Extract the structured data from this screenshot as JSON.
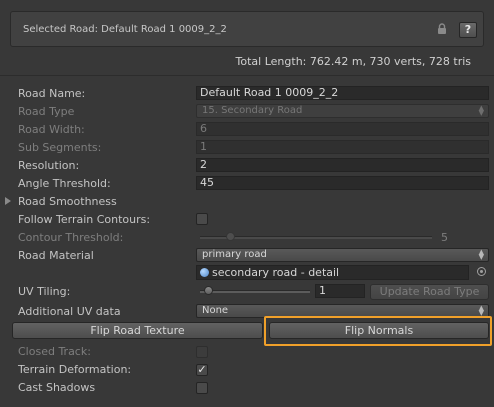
{
  "header": {
    "selected_road": "Selected Road:  Default Road 1 0009_2_2",
    "help_label": "?",
    "total_length": "Total Length: 762.42 m, 730 verts, 728 tris"
  },
  "fields": {
    "road_name": {
      "label": "Road Name:",
      "value": "Default Road 1 0009_2_2"
    },
    "road_type": {
      "label": "Road Type",
      "value": "15. Secondary Road"
    },
    "road_width": {
      "label": "Road Width:",
      "value": "6"
    },
    "sub_segments": {
      "label": "Sub Segments:",
      "value": "1"
    },
    "resolution": {
      "label": "Resolution:",
      "value": "2"
    },
    "angle_threshold": {
      "label": "Angle Threshold:",
      "value": "45"
    },
    "road_smoothness": {
      "label": "Road Smoothness"
    },
    "follow_terrain": {
      "label": "Follow Terrain Contours:",
      "checked": false
    },
    "contour_threshold": {
      "label": "Contour Threshold:",
      "value": "5",
      "level": 5
    },
    "road_material": {
      "label": "Road Material",
      "value": "primary road",
      "object": "secondary road - detail"
    },
    "uv_tiling": {
      "label": "UV Tiling:",
      "value": "1",
      "level": 1
    },
    "additional_uv": {
      "label": "Additional UV data",
      "value": "None"
    },
    "closed_track": {
      "label": "Closed Track:",
      "checked": false
    },
    "terrain_deformation": {
      "label": "Terrain Deformation:",
      "checked": true
    },
    "cast_shadows": {
      "label": "Cast Shadows",
      "checked": false
    }
  },
  "buttons": {
    "update_road_type": "Update Road Type",
    "flip_road_texture": "Flip Road Texture",
    "flip_normals": "Flip Normals"
  },
  "symbols": {
    "checkmark": "✓"
  },
  "colors": {
    "highlight": "#f0a02a",
    "background": "#383838"
  }
}
